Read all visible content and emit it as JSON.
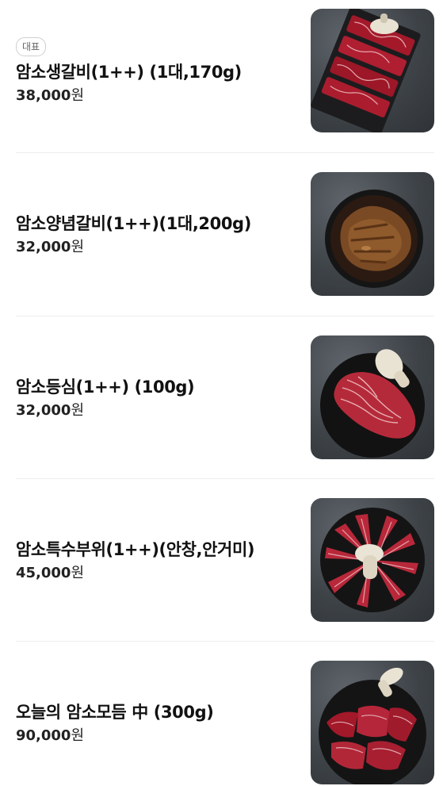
{
  "menu": {
    "items": [
      {
        "badge": "대표",
        "name": "암소생갈비(1++) (1대,170g)",
        "price": "38,000",
        "currency": "원",
        "image": "raw-galbi-photo"
      },
      {
        "badge": "",
        "name": "암소양념갈비(1++)(1대,200g)",
        "price": "32,000",
        "currency": "원",
        "image": "marinated-galbi-photo"
      },
      {
        "badge": "",
        "name": "암소등심(1++) (100g)",
        "price": "32,000",
        "currency": "원",
        "image": "sirloin-photo"
      },
      {
        "badge": "",
        "name": "암소특수부위(1++)(안창,안거미)",
        "price": "45,000",
        "currency": "원",
        "image": "special-cuts-photo"
      },
      {
        "badge": "",
        "name": "오늘의 암소모듬 中 (300g)",
        "price": "90,000",
        "currency": "원",
        "image": "assorted-platter-photo"
      }
    ]
  }
}
